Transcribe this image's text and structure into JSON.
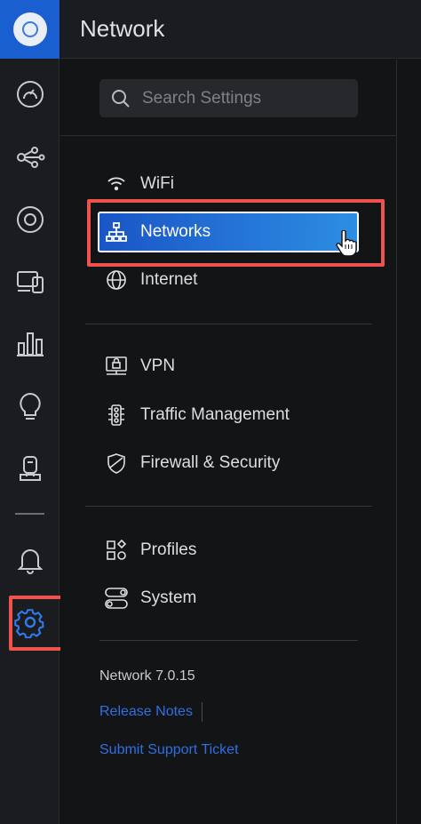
{
  "header": {
    "title": "Network"
  },
  "search": {
    "placeholder": "Search Settings"
  },
  "rail": {
    "items": [
      {
        "name": "dashboard-icon"
      },
      {
        "name": "topology-icon"
      },
      {
        "name": "devices-icon"
      },
      {
        "name": "clients-icon"
      },
      {
        "name": "statistics-icon"
      },
      {
        "name": "insights-icon"
      },
      {
        "name": "protect-icon"
      },
      {
        "name": "notifications-bell-icon"
      },
      {
        "name": "settings-gear-icon"
      }
    ]
  },
  "nav": {
    "wifi": "WiFi",
    "networks": "Networks",
    "internet": "Internet",
    "vpn": "VPN",
    "traffic": "Traffic Management",
    "firewall": "Firewall & Security",
    "profiles": "Profiles",
    "system": "System"
  },
  "footer": {
    "version": "Network 7.0.15",
    "release_notes": "Release Notes",
    "support": "Submit Support Ticket"
  },
  "colors": {
    "accent": "#1a5fd0",
    "highlight": "#f0534e",
    "link": "#2f6fe0",
    "background": "#131416"
  }
}
